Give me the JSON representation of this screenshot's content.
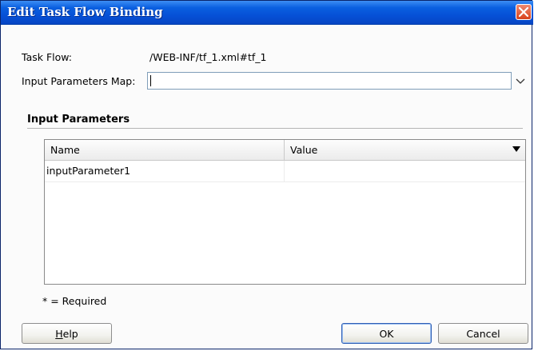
{
  "window": {
    "title": "Edit Task Flow Binding"
  },
  "form": {
    "task_flow_label": "Task Flow:",
    "task_flow_value": "/WEB-INF/tf_1.xml#tf_1",
    "input_map_label": "Input Parameters Map:",
    "input_map_value": ""
  },
  "section": {
    "title": "Input Parameters"
  },
  "table": {
    "columns": [
      "Name",
      "Value"
    ],
    "rows": [
      {
        "name": "inputParameter1",
        "value": ""
      }
    ]
  },
  "footer": {
    "required_note": "* = Required",
    "help_prefix": "",
    "help_mnemonic": "H",
    "help_rest": "elp",
    "ok_label": "OK",
    "cancel_label": "Cancel"
  },
  "icons": {
    "close": "close-icon",
    "combo_dropdown": "chevron-down-icon",
    "column_dropdown": "triangle-down-icon"
  },
  "colors": {
    "titlebar": "#0650d6",
    "close_button": "#d8421c",
    "field_border": "#7f9db9"
  }
}
